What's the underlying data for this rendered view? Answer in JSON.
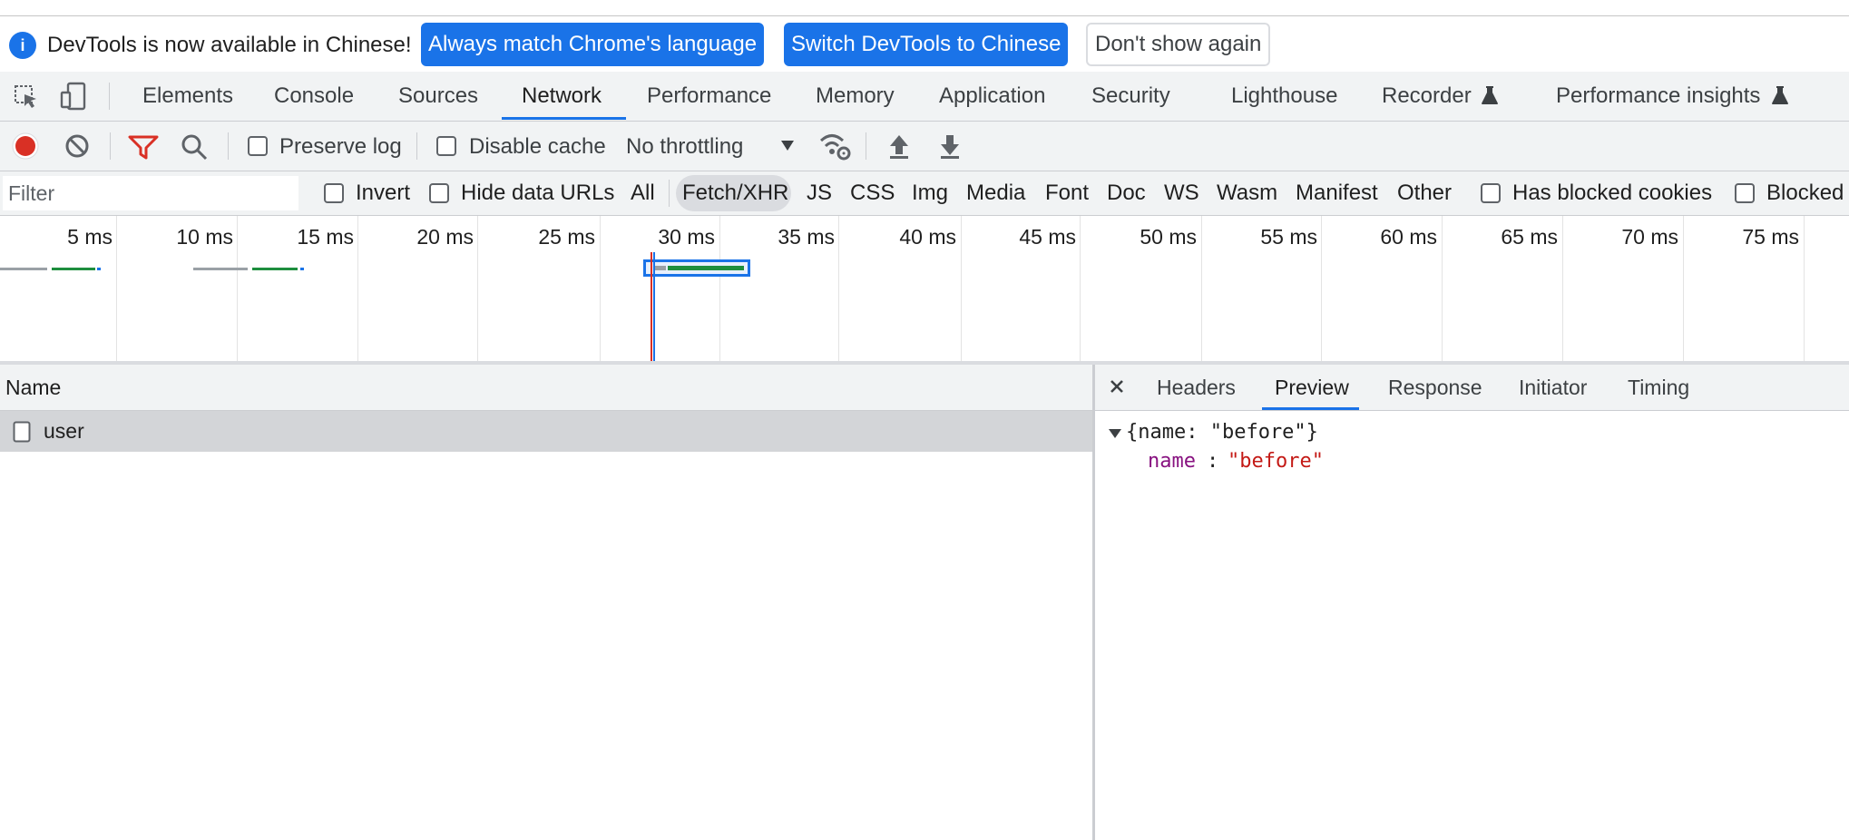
{
  "infobar": {
    "message": "DevTools is now available in Chinese!",
    "buttons": {
      "always_match": "Always match Chrome's language",
      "switch": "Switch DevTools to Chinese",
      "dont_show": "Don't show again"
    }
  },
  "main_tabs": [
    "Elements",
    "Console",
    "Sources",
    "Network",
    "Performance",
    "Memory",
    "Application",
    "Security",
    "Lighthouse",
    "Recorder",
    "Performance insights"
  ],
  "active_main_tab": "Network",
  "network_toolbar": {
    "preserve_log": "Preserve log",
    "disable_cache": "Disable cache",
    "throttling": "No throttling"
  },
  "filter_bar": {
    "placeholder": "Filter",
    "invert": "Invert",
    "hide_data_urls": "Hide data URLs",
    "types": [
      "All",
      "Fetch/XHR",
      "JS",
      "CSS",
      "Img",
      "Media",
      "Font",
      "Doc",
      "WS",
      "Wasm",
      "Manifest",
      "Other"
    ],
    "active_type": "Fetch/XHR",
    "has_blocked_cookies": "Has blocked cookies",
    "blocked_requests": "Blocked"
  },
  "overview": {
    "ticks": [
      "5 ms",
      "10 ms",
      "15 ms",
      "20 ms",
      "25 ms",
      "30 ms",
      "35 ms",
      "40 ms",
      "45 ms",
      "50 ms",
      "55 ms",
      "60 ms",
      "65 ms",
      "70 ms",
      "75 ms"
    ]
  },
  "request_list": {
    "column_name": "Name",
    "rows": [
      {
        "name": "user"
      }
    ]
  },
  "detail": {
    "tabs": [
      "Headers",
      "Preview",
      "Response",
      "Initiator",
      "Timing"
    ],
    "active_tab": "Preview",
    "preview": {
      "summary": "{name: \"before\"}",
      "key": "name",
      "value": "\"before\""
    }
  },
  "colors": {
    "accent": "#1a73e8",
    "record": "#d93025",
    "filter_active": "#d93025",
    "json_key": "#881280",
    "json_string": "#c41a16",
    "waiting_bar": "#9aa0a6",
    "download_bar": "#1e8e3e"
  }
}
